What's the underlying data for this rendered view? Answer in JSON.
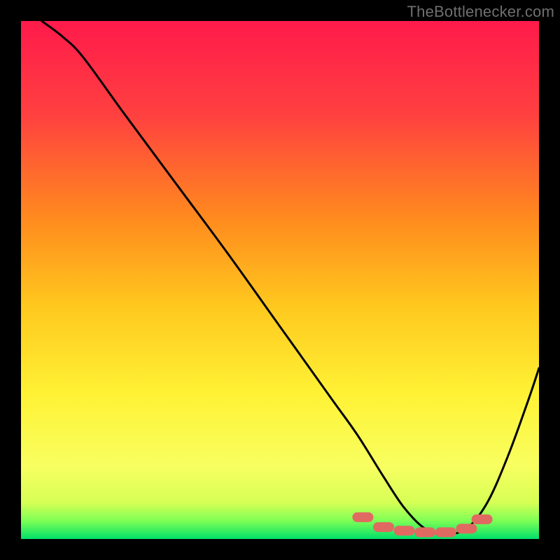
{
  "watermark": "TheBottlenecker.com",
  "chart_data": {
    "type": "line",
    "title": "",
    "xlabel": "",
    "ylabel": "",
    "xlim": [
      0,
      100
    ],
    "ylim": [
      0,
      100
    ],
    "series": [
      {
        "name": "curve",
        "x": [
          4,
          8,
          12,
          20,
          30,
          40,
          50,
          60,
          65,
          70,
          74,
          78,
          82,
          86,
          90,
          94,
          98,
          100
        ],
        "y": [
          100,
          97,
          93,
          82,
          68.5,
          55,
          41,
          27,
          20,
          12,
          6,
          2,
          1,
          2,
          7,
          16,
          27,
          33
        ]
      }
    ],
    "optimal_markers": {
      "x": [
        66,
        70,
        74,
        78,
        82,
        86,
        89
      ],
      "y": [
        4.2,
        2.3,
        1.6,
        1.3,
        1.3,
        2.0,
        3.8
      ]
    },
    "background_gradient": {
      "stops": [
        {
          "offset": 0.0,
          "color": "#ff1a4b"
        },
        {
          "offset": 0.18,
          "color": "#ff4040"
        },
        {
          "offset": 0.38,
          "color": "#ff8a1e"
        },
        {
          "offset": 0.55,
          "color": "#ffc81e"
        },
        {
          "offset": 0.72,
          "color": "#fff235"
        },
        {
          "offset": 0.86,
          "color": "#f8ff60"
        },
        {
          "offset": 0.93,
          "color": "#d6ff55"
        },
        {
          "offset": 0.965,
          "color": "#7dff55"
        },
        {
          "offset": 1.0,
          "color": "#00e06a"
        }
      ]
    }
  }
}
